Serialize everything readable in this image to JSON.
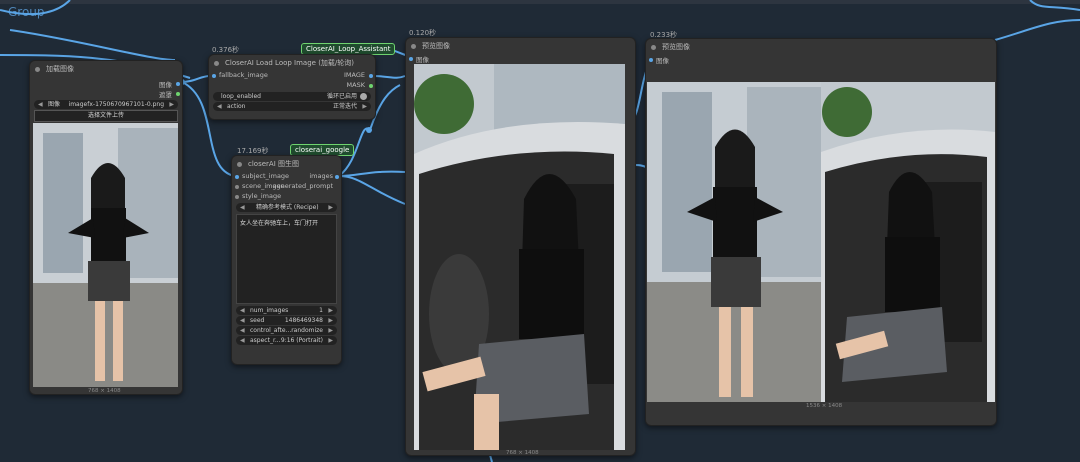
{
  "group": {
    "title": "Group"
  },
  "load_image_node": {
    "title": "加载图像",
    "outputs": [
      "图像",
      "遮罩"
    ],
    "image_label": "图像",
    "image_value": "imagefx-1750670967101-0.png",
    "upload_label": "选择文件上传",
    "dims": "768 × 1408"
  },
  "loop_node": {
    "timing": "0.376秒",
    "badge": "CloserAI_Loop_Assistant",
    "title": "CloserAI Load Loop Image (加载/轮询)",
    "input_fallback": "fallback_image",
    "outputs": [
      "IMAGE",
      "MASK"
    ],
    "loop_label": "loop_enabled",
    "loop_value": "循环已启用",
    "action_label": "action",
    "action_value": "正常迭代"
  },
  "gen_node": {
    "timing": "17.169秒",
    "badge": "closerai_google",
    "title": "closerAI 图生图",
    "inputs": [
      "subject_image",
      "scene_image",
      "style_image"
    ],
    "outputs": [
      "images",
      "generated_prompt"
    ],
    "recipe_value": "精确参考模式 (Recipe)",
    "prompt_text": "女人坐在奔驰车上，车门打开",
    "widgets": [
      {
        "label": "num_images",
        "value": "1"
      },
      {
        "label": "seed",
        "value": "1486469348"
      },
      {
        "label": "control_afte...",
        "value": "randomize"
      },
      {
        "label": "aspect_r...",
        "value": "9:16 (Portrait)"
      }
    ]
  },
  "preview1": {
    "timing": "0.120秒",
    "title": "预览图像",
    "input": "图像",
    "dims": "768 × 1408"
  },
  "preview2": {
    "timing": "0.233秒",
    "title": "预览图像",
    "input": "图像",
    "dims": "1536 × 1408"
  },
  "colors": {
    "canvas": "#1f2a36",
    "node": "#353535",
    "link_blue": "#5aa5e6",
    "badge_green": "#6fd36f"
  }
}
